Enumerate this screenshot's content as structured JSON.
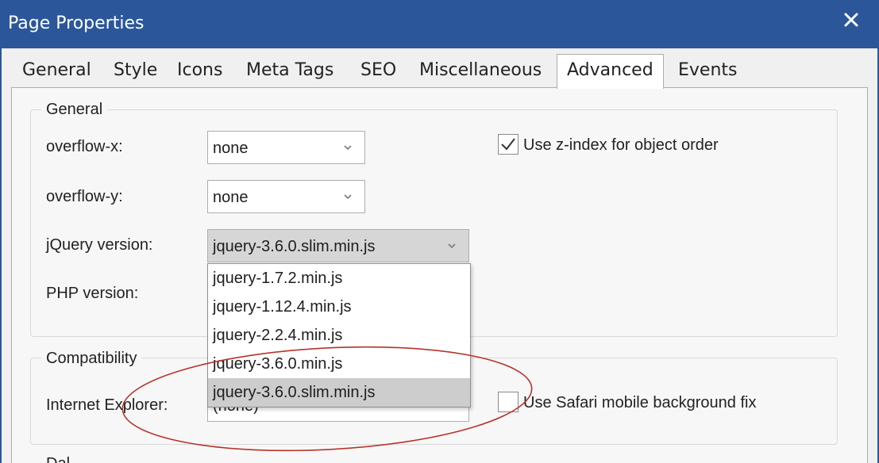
{
  "window": {
    "title": "Page Properties",
    "close_icon": "close-icon"
  },
  "tabs": [
    {
      "label": "General"
    },
    {
      "label": "Style"
    },
    {
      "label": "Icons"
    },
    {
      "label": "Meta Tags"
    },
    {
      "label": "SEO"
    },
    {
      "label": "Miscellaneous"
    },
    {
      "label": "Advanced",
      "active": true
    },
    {
      "label": "Events"
    }
  ],
  "general": {
    "legend": "General",
    "overflow_x": {
      "label": "overflow-x:",
      "value": "none"
    },
    "overflow_y": {
      "label": "overflow-y:",
      "value": "none"
    },
    "jquery": {
      "label": "jQuery version:",
      "value": "jquery-3.6.0.slim.min.js"
    },
    "php": {
      "label": "PHP version:"
    },
    "zindex": {
      "label": "Use z-index for object order",
      "checked": true
    }
  },
  "compatibility": {
    "legend": "Compatibility",
    "ie": {
      "label": "Internet Explorer:",
      "value": "(none)"
    },
    "safari": {
      "label": "Use Safari mobile background fix",
      "checked": false
    }
  },
  "next_section_partial": "Dal",
  "jquery_options": [
    "jquery-1.7.2.min.js",
    "jquery-1.12.4.min.js",
    "jquery-2.2.4.min.js",
    "jquery-3.6.0.min.js",
    "jquery-3.6.0.slim.min.js"
  ],
  "jquery_selected_index": 4,
  "colors": {
    "titlebar": "#2b579a",
    "annotation_ellipse": "#b5342c",
    "selected_option": "#cdcdcd"
  }
}
